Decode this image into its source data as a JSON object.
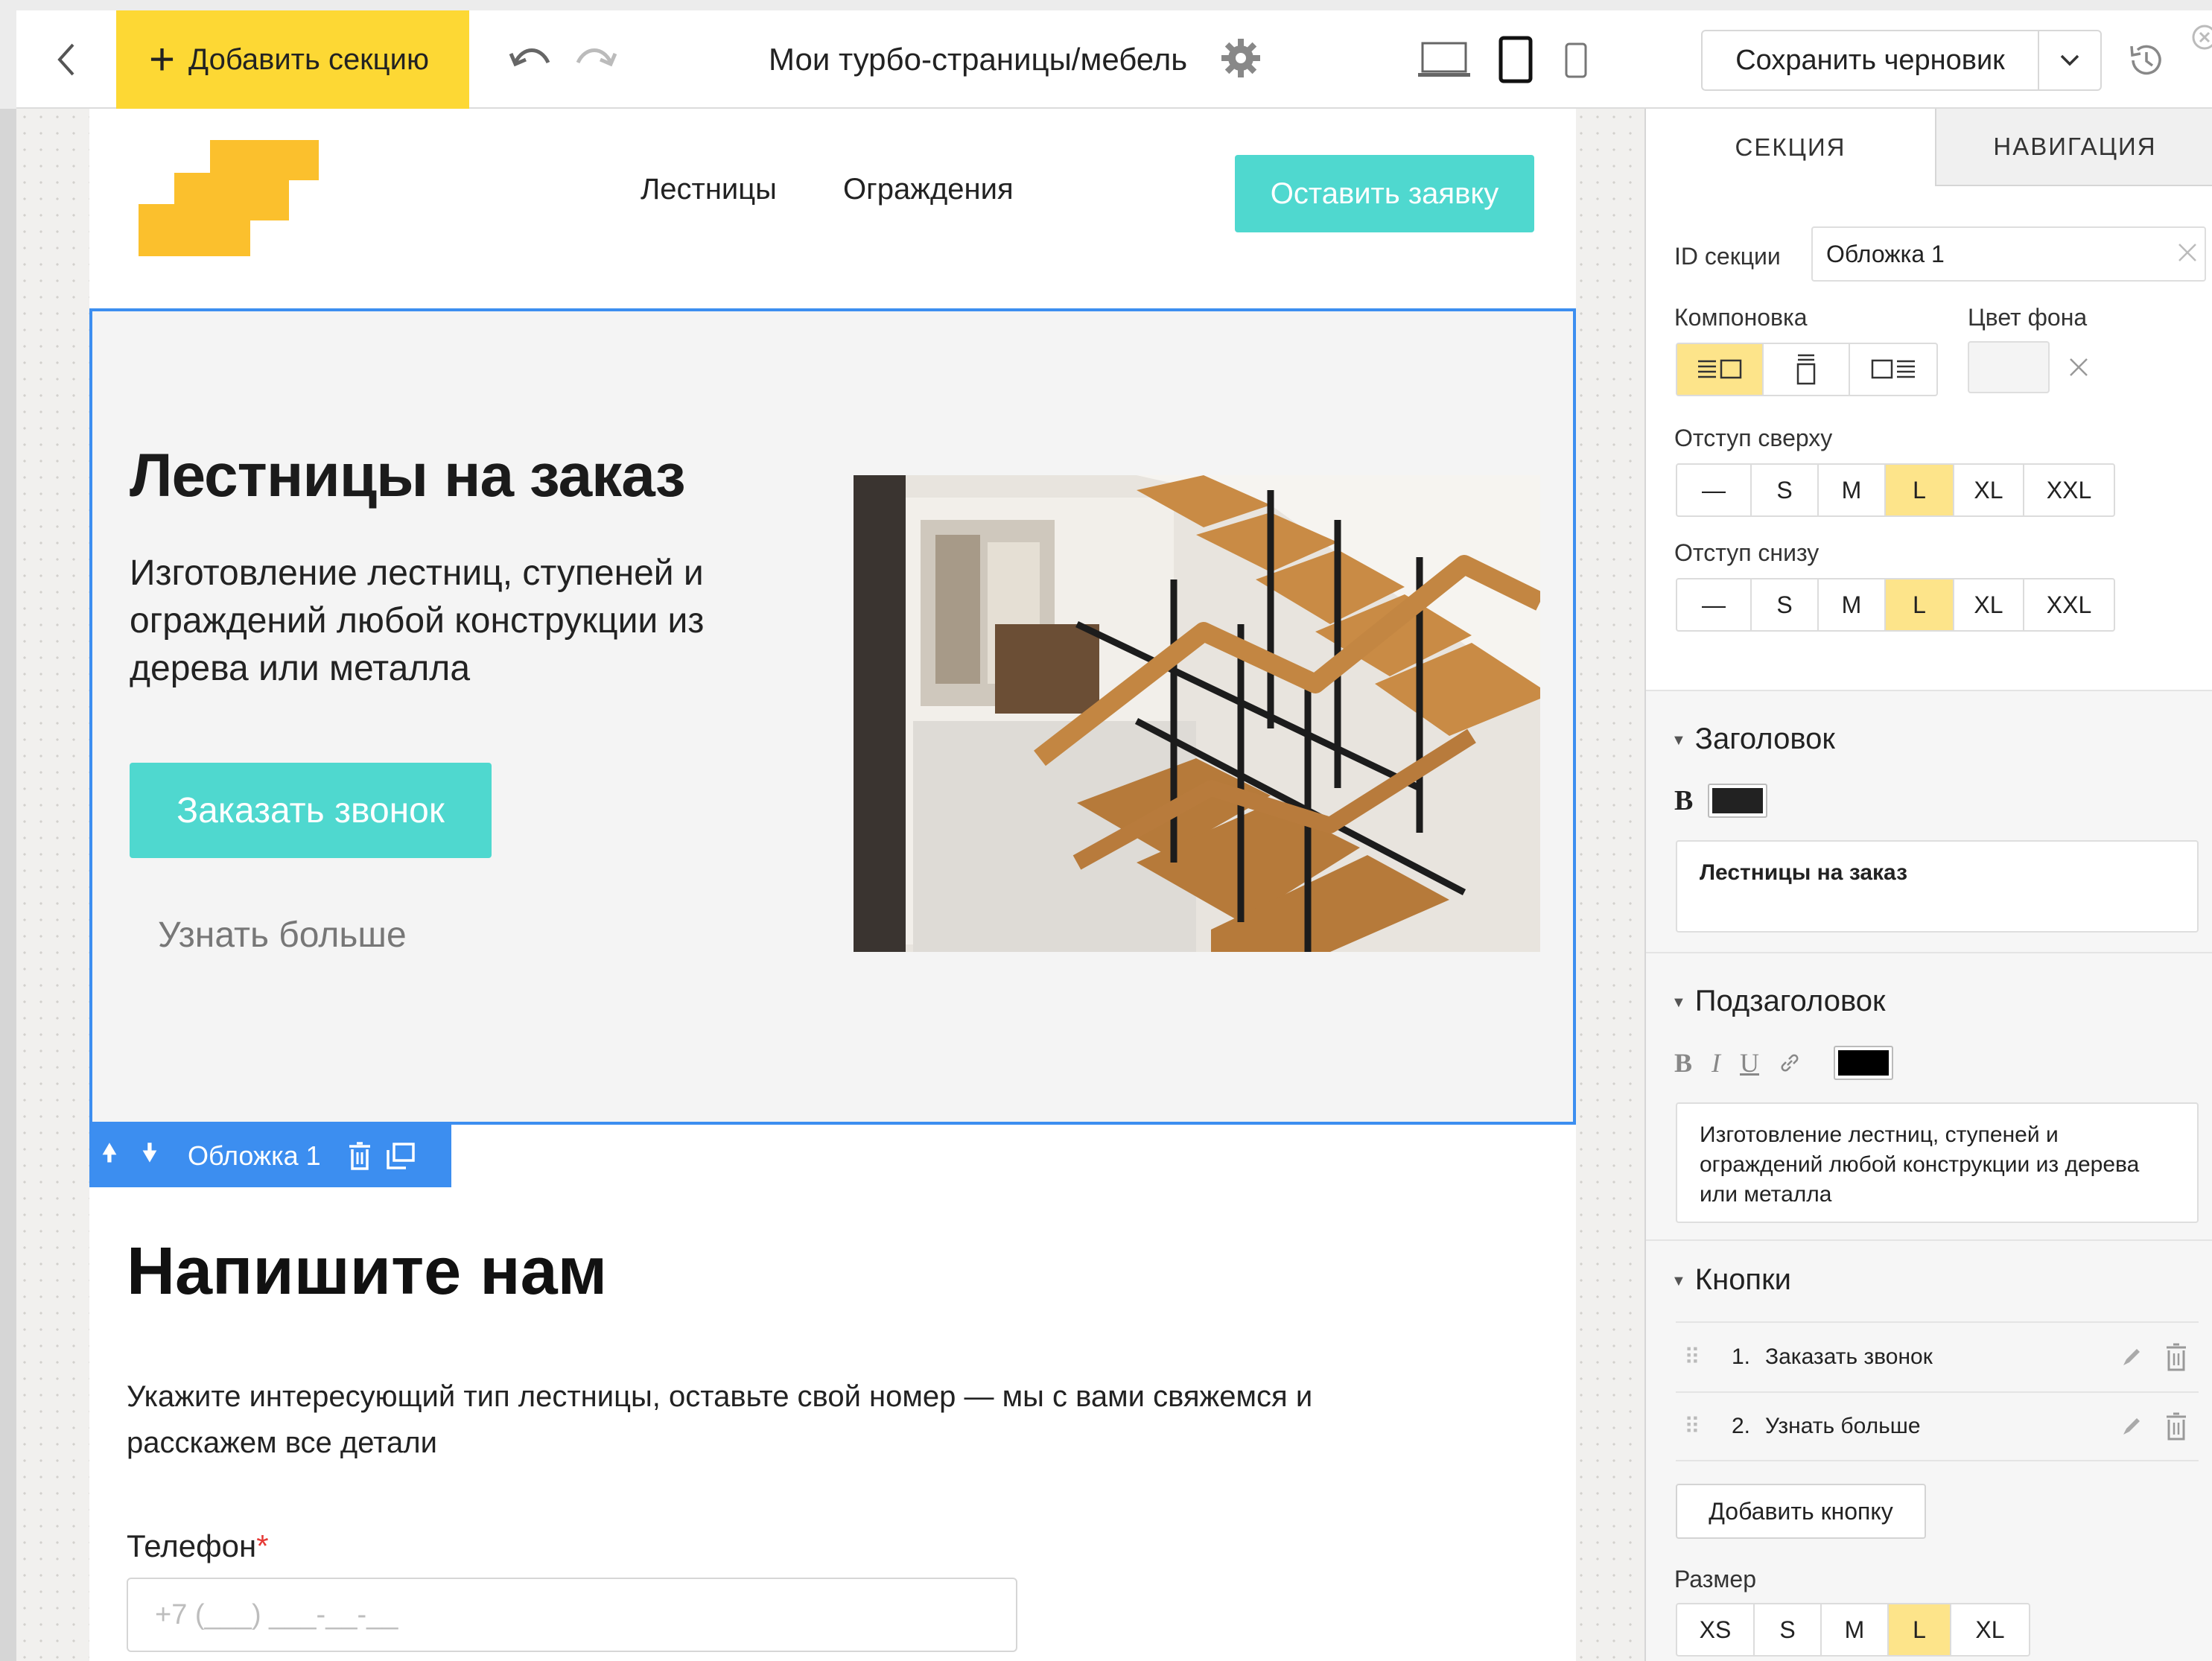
{
  "topbar": {
    "add_section_label": "Добавить секцию",
    "breadcrumb": "Мои турбо-страницы/мебель",
    "save_draft_label": "Сохранить черновик"
  },
  "site": {
    "nav": [
      "Лестницы",
      "Ограждения"
    ],
    "cta_label": "Оставить заявку",
    "brand_color": "#FBC02D",
    "accent_color": "#4FD8CF"
  },
  "hero": {
    "title": "Лестницы на заказ",
    "subtitle": "Изготовление лестниц, ступеней и ограждений любой конструкции из дерева или металла",
    "primary_button": "Заказать звонок",
    "secondary_button": "Узнать больше"
  },
  "section_tag": {
    "label": "Обложка 1",
    "color": "#3C8EF0"
  },
  "contact": {
    "title": "Напишите нам",
    "description": "Укажите интересующий тип лестницы, оставьте свой номер — мы с вами свяжемся и расскажем все детали",
    "phone_label": "Телефон",
    "required_mark": "*",
    "phone_placeholder": "+7 (___) ___-__-__"
  },
  "panel": {
    "tabs": [
      "СЕКЦИЯ",
      "НАВИГАЦИЯ"
    ],
    "section_id_label": "ID секции",
    "section_id_value": "Обложка 1",
    "layout_label": "Компоновка",
    "bg_color_label": "Цвет фона",
    "padding_top_label": "Отступ сверху",
    "padding_bottom_label": "Отступ снизу",
    "padding_options": [
      "—",
      "S",
      "M",
      "L",
      "XL",
      "XXL"
    ],
    "padding_top_selected": "L",
    "padding_bottom_selected": "L",
    "heading_group": "Заголовок",
    "heading_bold": "B",
    "heading_color": "#222222",
    "heading_text": "Лестницы на заказ",
    "subheading_group": "Подзаголовок",
    "subheading_format": [
      "B",
      "I",
      "U"
    ],
    "subheading_color": "#000000",
    "subheading_text": "Изготовление лестниц, ступеней и ограждений любой конструкции из дерева или металла",
    "buttons_group": "Кнопки",
    "buttons": [
      {
        "num": "1.",
        "name": "Заказать звонок"
      },
      {
        "num": "2.",
        "name": "Узнать больше"
      }
    ],
    "add_button_label": "Добавить кнопку",
    "size_label": "Размер",
    "size_options": [
      "XS",
      "S",
      "M",
      "L",
      "XL"
    ],
    "size_selected": "L"
  },
  "icons": {
    "back": "chevron-left-icon",
    "undo": "undo-icon",
    "redo": "redo-icon",
    "settings": "gear-icon",
    "history": "history-icon"
  }
}
